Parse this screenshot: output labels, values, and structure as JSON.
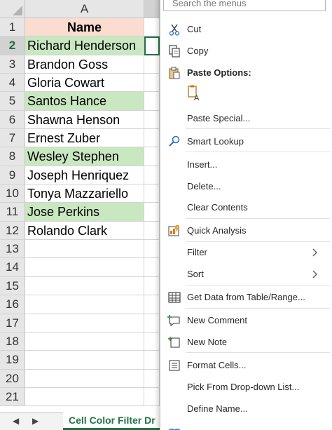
{
  "sheet": {
    "column_a_header": "A",
    "row_numbers": [
      "1",
      "2",
      "3",
      "4",
      "5",
      "6",
      "7",
      "8",
      "9",
      "10",
      "11",
      "12",
      "13",
      "14",
      "15",
      "16",
      "17",
      "18",
      "19",
      "20",
      "21"
    ],
    "cells": [
      "Name",
      "Richard Henderson",
      "Brandon Goss",
      "Gloria Cowart",
      "Santos Hance",
      "Shawna Henson",
      "Ernest Zuber",
      "Wesley Stephen",
      "Joseph Henriquez",
      "Tonya Mazzariello",
      "Jose Perkins",
      "Rolando Clark"
    ],
    "tab_name": "Cell Color Filter Dr",
    "colors": {
      "header_fill": "#fbdcd0",
      "highlight_fill": "#c9e7c0",
      "accent": "#217346"
    }
  },
  "menu": {
    "search_placeholder": "Search the menus",
    "cut": "Cut",
    "copy": "Copy",
    "paste_options": "Paste Options:",
    "paste_special": "Paste Special...",
    "smart_lookup": "Smart Lookup",
    "insert": "Insert...",
    "delete": "Delete...",
    "clear_contents": "Clear Contents",
    "quick_analysis": "Quick Analysis",
    "filter": "Filter",
    "sort": "Sort",
    "get_data": "Get Data from Table/Range...",
    "new_comment": "New Comment",
    "new_note": "New Note",
    "format_cells": "Format Cells...",
    "pick_dropdown": "Pick From Drop-down List...",
    "define_name": "Define Name..."
  }
}
